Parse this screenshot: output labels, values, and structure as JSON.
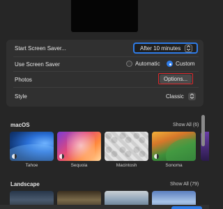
{
  "settings": {
    "start_label": "Start Screen Saver...",
    "start_value": "After 10 minutes",
    "use_label": "Use Screen Saver",
    "radio_automatic": "Automatic",
    "radio_custom": "Custom",
    "radio_selected": "Custom",
    "photos_label": "Photos",
    "options_button": "Options...",
    "style_label": "Style",
    "style_value": "Classic"
  },
  "macos": {
    "title": "macOS",
    "show_all": "Show All (6)",
    "items": [
      {
        "label": "Tahoe"
      },
      {
        "label": "Sequoia"
      },
      {
        "label": "Macintosh"
      },
      {
        "label": "Sonoma"
      }
    ]
  },
  "landscape": {
    "title": "Landscape",
    "show_all": "Show All (79)"
  },
  "colors": {
    "accent": "#2f7ce8",
    "highlight_outline": "#e0282c",
    "background": "#262626",
    "group_background": "#303030"
  },
  "icons": [
    "chevron-updown-icon",
    "dynamic-wallpaper-badge-icon"
  ]
}
